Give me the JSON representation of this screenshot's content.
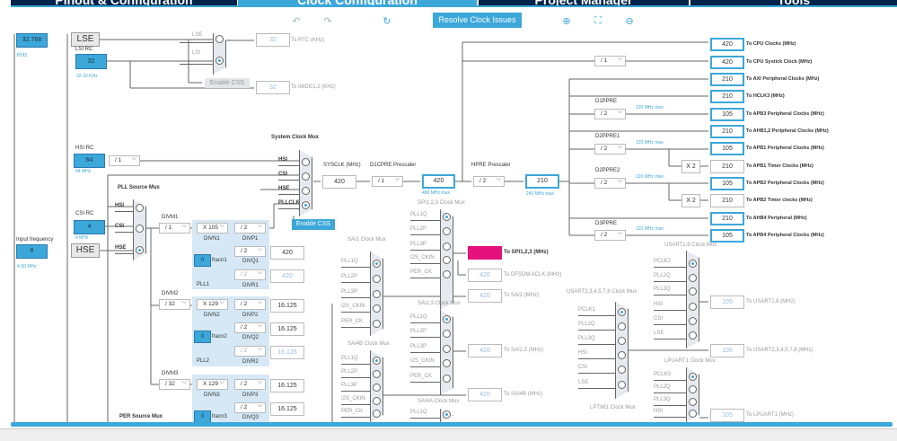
{
  "tabs": [
    "Pinout & Configuration",
    "Clock Configuration",
    "Project Manager",
    "Tools"
  ],
  "toolbar": {
    "resolve_label": "Resolve Clock Issues",
    "icons": [
      "undo-icon",
      "redo-icon",
      "refresh-icon",
      "zoom-in-icon",
      "fit-icon",
      "zoom-out-icon"
    ]
  },
  "lse": {
    "value": "32.768",
    "unit": "KHz",
    "label": "LSE"
  },
  "lsi": {
    "label": "LSI RC",
    "value": "32",
    "range": "32-32 KHz"
  },
  "rtc_mux": {
    "inputs": [
      "LSE",
      "LSI"
    ],
    "selected": 1,
    "css_label": "Enable CSS"
  },
  "rtc_out": {
    "value": "32",
    "label": "To RTC (KHz)"
  },
  "iwdg_out": {
    "value": "32",
    "label": "To IWDG1,2 (KHz)"
  },
  "hsi": {
    "label": "HSI RC",
    "value": "64",
    "unit": "64 MHz",
    "div": "/ 1"
  },
  "csi": {
    "label": "CSI RC",
    "value": "4",
    "unit": "4 MHz"
  },
  "hse": {
    "label": "Input frequency",
    "value": "8",
    "range": "4-50 MHz",
    "name": "HSE"
  },
  "sys_mux": {
    "title": "System Clock Mux",
    "inputs": [
      "HSI",
      "CSI",
      "HSE",
      "PLLCLK"
    ],
    "selected": 3,
    "css_label": "Enable CSS"
  },
  "sysclk": {
    "label": "SYSCLK (MHz)",
    "value": "420"
  },
  "d1cpre": {
    "label": "D1CPRE Prescaler",
    "value": "/ 1"
  },
  "cpu": {
    "value": "420",
    "max": "480 MHz max"
  },
  "hpre": {
    "label": "HPRE Prescaler",
    "value": "/ 2"
  },
  "hclk": {
    "value": "210",
    "max": "240 MHz max"
  },
  "pll_src": {
    "title": "PLL Source Mux",
    "inputs": [
      "HSI",
      "CSI",
      "HSE"
    ],
    "selected": 2
  },
  "plls": [
    {
      "name": "PLL1",
      "divm_label": "DIVM1",
      "divm": "/ 1",
      "divn": "X 105",
      "divn_label": "DIVN1",
      "divp": "/ 2",
      "divp_label": "DIVP1",
      "divq": "/ 2",
      "divq_label": "DIVQ1",
      "divr": "/ 2",
      "divr_label": "DIVR1",
      "fracn": "0",
      "fracn_label": "fracn1",
      "q_out": "420",
      "r_out": "420"
    },
    {
      "name": "PLL2",
      "divm_label": "DIVM2",
      "divm": "/ 32",
      "divn": "X 129",
      "divn_label": "DIVN2",
      "divp": "/ 2",
      "divp_label": "DIVP2",
      "divq": "/ 2",
      "divq_label": "DIVQ2",
      "divr": "/ 2",
      "divr_label": "DIVR2",
      "fracn": "0",
      "fracn_label": "fracn2",
      "p_out": "16.125",
      "q_out": "16.125",
      "r_out": "16.125"
    },
    {
      "name": "PLL3",
      "divm_label": "DIVM3",
      "divm": "/ 32",
      "divn": "X 129",
      "divn_label": "DIVN3",
      "divp": "/ 2",
      "divp_label": "DIVP3",
      "divq": "/ 2",
      "divq_label": "DIVQ3",
      "fracn": "0",
      "fracn_label": "fracn3",
      "p_out": "16.125",
      "q_out": "16.125"
    }
  ],
  "bus": {
    "systick_div": "/ 1",
    "d1ppre": {
      "label": "D1PPRE",
      "value": "/ 2",
      "max": "120 MHz max"
    },
    "d2ppre1": {
      "label": "D2PPRE1",
      "value": "/ 2",
      "max": "120 MHz max"
    },
    "d2ppre2": {
      "label": "D2PPRE2",
      "value": "/ 2",
      "max": "120 MHz max"
    },
    "d3ppre": {
      "label": "D3PPRE",
      "value": "/ 2",
      "max": "120 MHz max"
    },
    "x2": "X 2"
  },
  "outputs": [
    {
      "value": "420",
      "label": "To CPU Clocks (MHz)"
    },
    {
      "value": "420",
      "label": "To CPU Systick Clock (MHz)"
    },
    {
      "value": "210",
      "label": "To AXI Peripheral Clocks (MHz)"
    },
    {
      "value": "210",
      "label": "To HCLK3 (MHz)"
    },
    {
      "value": "105",
      "label": "To APB3 Peripheral Clocks (MHz)"
    },
    {
      "value": "210",
      "label": "To AHB1,2 Peripheral Clocks (MHz)"
    },
    {
      "value": "105",
      "label": "To APB1 Peripheral Clocks (MHz)"
    },
    {
      "value": "210",
      "label": "To APB1 Timer Clocks (MHz)"
    },
    {
      "value": "105",
      "label": "To APB2 Peripheral Clocks (MHz)"
    },
    {
      "value": "210",
      "label": "To APB2 Timer clocks (MHz)"
    },
    {
      "value": "210",
      "label": "To AHB4 Peripheral (MHz)"
    },
    {
      "value": "105",
      "label": "To APB4 Peripheral Clocks (MHz)"
    }
  ],
  "muxes": {
    "spi123": {
      "title": "SPI1,2,3 Clock Mux",
      "inputs": [
        "PLL1Q",
        "PLL2P",
        "PLL3P",
        "I2S_CKIN",
        "PER_CK"
      ],
      "selected": 0
    },
    "sai1": {
      "title": "SAI1 Clock Mux",
      "inputs": [
        "PLL1Q",
        "PLL2P",
        "PLL3P",
        "I2S_CKIN",
        "PER_CK"
      ],
      "selected": 0
    },
    "sai23": {
      "title": "SAI2,3 Clock Mux",
      "inputs": [
        "PLL1Q",
        "PLL2P",
        "PLL3P",
        "I2S_CKIN",
        "PER_CK"
      ],
      "selected": 0
    },
    "sai4b": {
      "title": "SAI4B Clock Mux",
      "inputs": [
        "PLL1Q",
        "PLL2P",
        "PLL3P",
        "I2S_CKIN",
        "PER_CK"
      ],
      "selected": 0
    },
    "sai4a": {
      "title": "SAI4A Clock Mux",
      "inputs": [
        "PLL1Q"
      ],
      "selected": 0
    },
    "usart234578": {
      "title": "USART2,3,4,5,7,8 Clock Mux",
      "inputs": [
        "PCLK1",
        "PLL2Q",
        "PLL3Q",
        "HSI",
        "CSI",
        "LSE"
      ],
      "selected": 0
    },
    "usart16": {
      "title": "USART1,6 Clock Mux",
      "inputs": [
        "PCLK2",
        "PLL2Q",
        "PLL3Q",
        "HSI",
        "CSI",
        "LSE"
      ],
      "selected": 0
    },
    "lpuart1": {
      "title": "LPUART1 Clock Mux",
      "inputs": [
        "PCLK3",
        "PLL2Q",
        "PLL3Q",
        "HSI"
      ],
      "selected": 0
    },
    "lptim1": {
      "title": "LPTIM1 Clock Mux"
    },
    "per": {
      "title": "PER Source Mux"
    }
  },
  "periph_out": {
    "spi": {
      "value": "420",
      "label": "To SPI1,2,3 (MHz)"
    },
    "dfsdm": {
      "value": "420",
      "label": "To DFSDM ACLK (MHz)"
    },
    "sai1": {
      "value": "420",
      "label": "To SAI1 (MHz)"
    },
    "sai23": {
      "value": "420",
      "label": "To SAI2,3 (MHz)"
    },
    "sai4b": {
      "value": "420",
      "label": "To SAI4B (MHz)"
    },
    "usart16": {
      "value": "105",
      "label": "To USART1,6 (MHz)"
    },
    "usart234578": {
      "value": "105",
      "label": "To USART2,3,4,5,7,8 (MHz)"
    },
    "lpuart1": {
      "value": "105",
      "label": "To LPUART1 (MHz)"
    }
  },
  "colors": {
    "accent": "#3ca7d9",
    "nav": "#03234b",
    "error": "#e5127d"
  }
}
